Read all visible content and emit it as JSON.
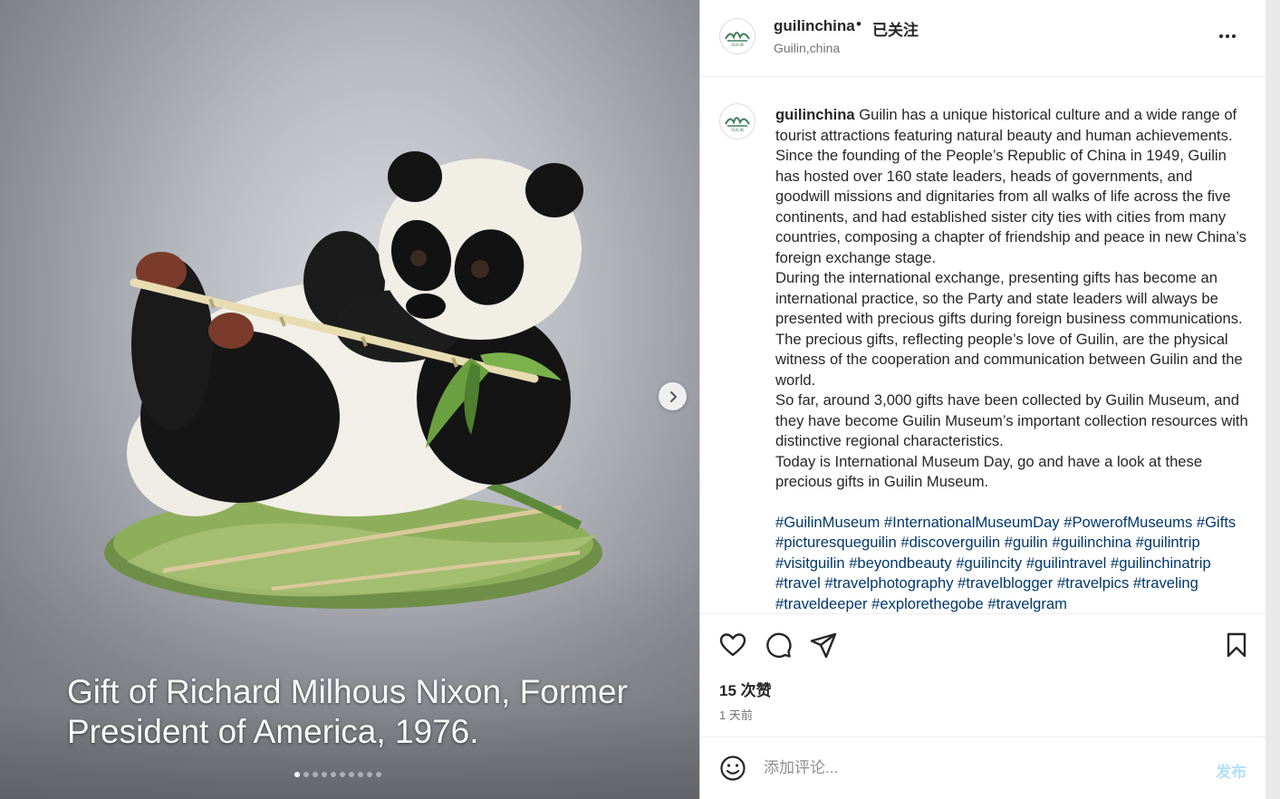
{
  "media": {
    "caption_line1": "Gift of Richard Milhous Nixon, Former",
    "caption_line2": "President of America, 1976.",
    "subject": "porcelain panda figurine eating bamboo",
    "next_icon": "chevron-right-icon",
    "carousel": {
      "total": 10,
      "active_index": 0
    }
  },
  "post_header": {
    "username": "guilinchina",
    "separator": "•",
    "follow_status": "已关注",
    "location": "Guilin,china",
    "more_icon": "more-horizontal-icon"
  },
  "caption": {
    "username": "guilinchina",
    "paragraph1": "Guilin has a unique historical culture and a wide range of tourist attractions featuring natural beauty and human achievements. Since the founding of the People’s Republic of China in 1949, Guilin has hosted over 160 state leaders, heads of governments, and goodwill missions and dignitaries from all walks of life across the five continents, and had established sister city ties with cities from many countries, composing a chapter of friendship and peace in new China’s foreign exchange stage.",
    "paragraph2": "During the international exchange, presenting gifts has become an international practice, so the Party and state leaders will always be presented with precious gifts during foreign business communications. The precious gifts, reflecting people’s love of Guilin, are the physical witness of the cooperation and communication between Guilin and the world.",
    "paragraph3": "So far, around 3,000 gifts have been collected by Guilin Museum, and they have become Guilin Museum’s important collection resources with distinctive regional characteristics.",
    "paragraph4": "Today is International Museum Day, go and have a look at these precious gifts in Guilin Museum.",
    "hashtags": [
      "#GuilinMuseum",
      "#InternationalMuseumDay",
      "#PowerofMuseums",
      "#Gifts",
      "#picturesqueguilin",
      "#discoverguilin",
      "#guilin",
      "#guilinchina",
      "#guilintrip",
      "#visitguilin",
      "#beyondbeauty",
      "#guilincity",
      "#guilintravel",
      "#guilinchinatrip",
      "#travel",
      "#travelphotography",
      "#travelblogger",
      "#travelpics",
      "#traveling",
      "#traveldeeper",
      "#explorethegobe",
      "#travelgram"
    ]
  },
  "actions": {
    "icons": [
      "heart-icon",
      "comment-icon",
      "share-icon",
      "bookmark-icon"
    ],
    "likes": "15 次赞",
    "time": "1 天前"
  },
  "composer": {
    "emoji_icon": "emoji-icon",
    "placeholder": "添加评论...",
    "post_label": "发布"
  },
  "colors": {
    "text": "#262626",
    "secondary": "#737373",
    "hashtag": "#00376b",
    "post_button": "#b2dffc",
    "border": "#dbdbdb"
  }
}
